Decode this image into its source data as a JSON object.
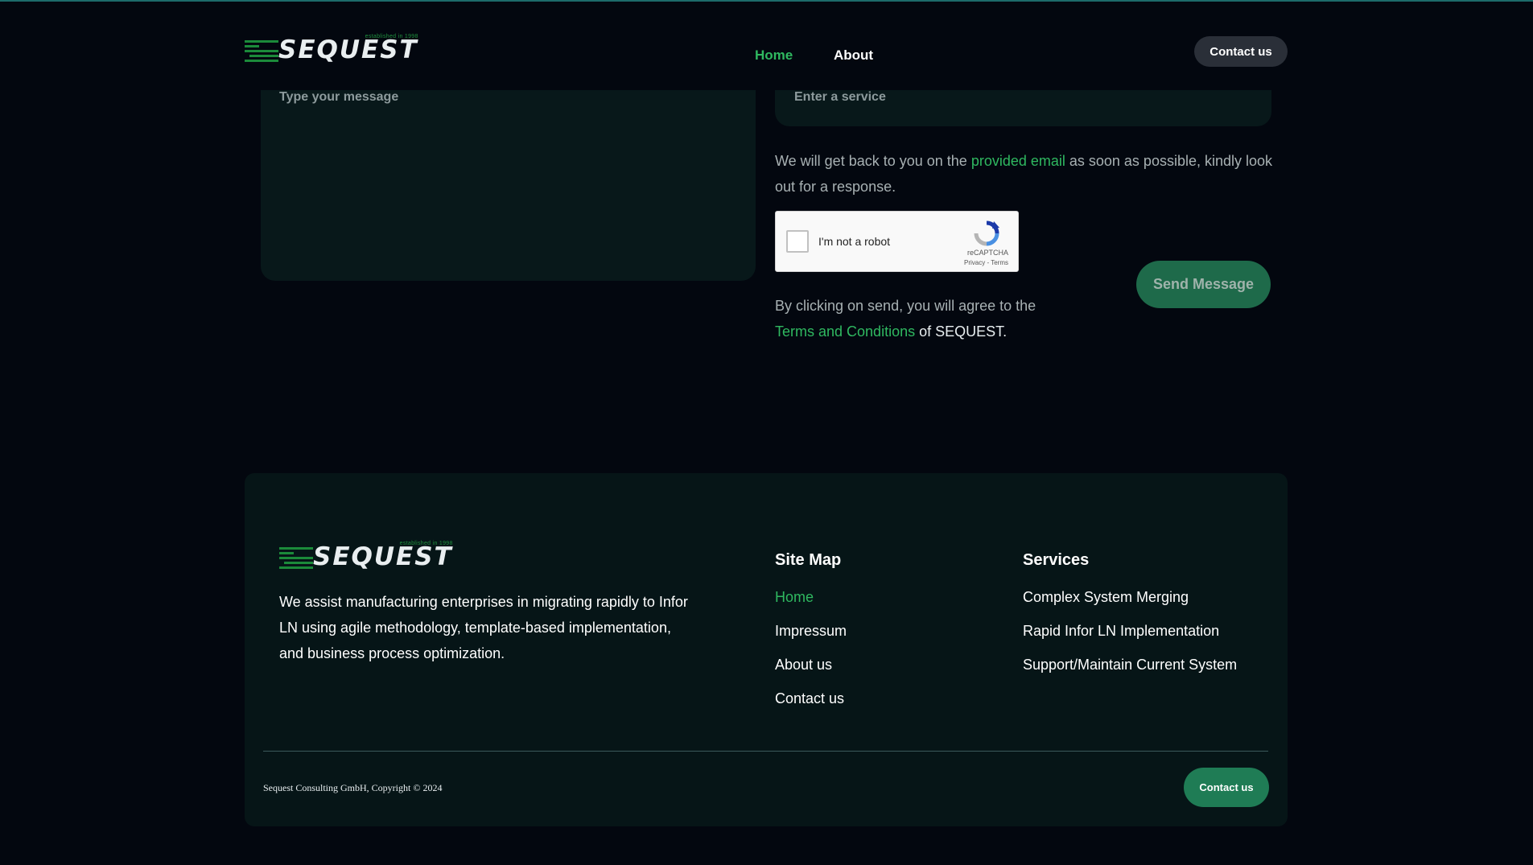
{
  "brand": {
    "name": "SEQUEST",
    "tagline": "established in 1998"
  },
  "nav": {
    "home": "Home",
    "about": "About",
    "contact_button": "Contact us"
  },
  "form": {
    "message_placeholder": "Type your message",
    "service_placeholder": "Enter a service",
    "info_before": "We will get back to you on the ",
    "info_link": "provided email",
    "info_after": " as soon as possible, kindly look out for a response.",
    "captcha": {
      "label": "I'm not a robot",
      "brand": "reCAPTCHA",
      "links": "Privacy - Terms"
    },
    "send_button": "Send Message",
    "agree_before": "By clicking on send, you will agree to the ",
    "agree_link": "Terms and Conditions",
    "agree_after": " of SEQUEST."
  },
  "footer": {
    "description": "We assist manufacturing enterprises in migrating rapidly to Infor LN using agile methodology, template-based implementation, and business process optimization.",
    "sitemap": {
      "title": "Site Map",
      "items": [
        "Home",
        "Impressum",
        "About us",
        "Contact us"
      ]
    },
    "services": {
      "title": "Services",
      "items": [
        "Complex System Merging",
        "Rapid Infor LN Implementation",
        "Support/Maintain Current System"
      ]
    },
    "copyright": "Sequest Consulting GmbH, Copyright © 2024",
    "contact_button": "Contact us"
  },
  "colors": {
    "accent": "#2fb860",
    "background": "#03070f",
    "panel": "#08181a",
    "footer": "#061517"
  }
}
